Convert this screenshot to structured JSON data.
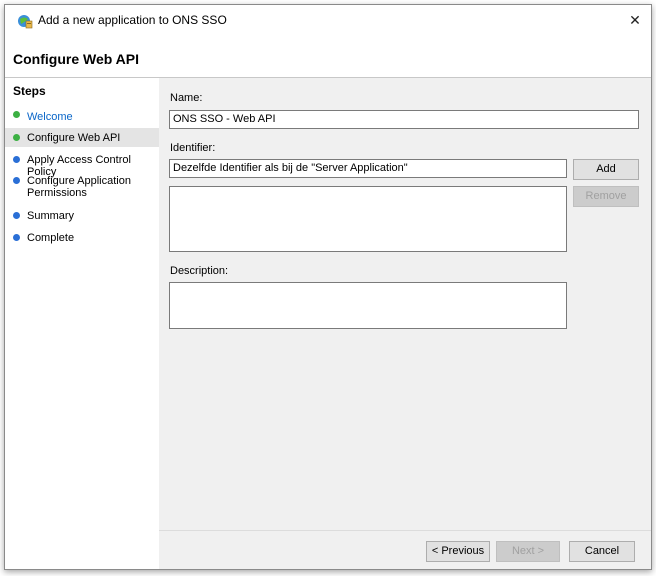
{
  "window": {
    "title": "Add a new application to ONS SSO",
    "close_label": "✕",
    "page_title": "Configure Web API"
  },
  "steps": {
    "heading": "Steps",
    "items": [
      {
        "label": "Welcome",
        "status": "complete",
        "color": "#3cb043"
      },
      {
        "label": "Configure Web API",
        "status": "current",
        "color": "#3cb043"
      },
      {
        "label": "Apply Access Control Policy",
        "status": "pending",
        "color": "#2a6fd6"
      },
      {
        "label": "Configure Application Permissions",
        "status": "pending",
        "color": "#2a6fd6"
      },
      {
        "label": "Summary",
        "status": "pending",
        "color": "#2a6fd6"
      },
      {
        "label": "Complete",
        "status": "pending",
        "color": "#2a6fd6"
      }
    ]
  },
  "form": {
    "name_label": "Name:",
    "name_value": "ONS SSO - Web API",
    "identifier_label": "Identifier:",
    "identifier_value": "Dezelfde Identifier als bij de \"Server Application\"",
    "add_label": "Add",
    "remove_label": "Remove",
    "description_label": "Description:",
    "description_value": ""
  },
  "footer": {
    "previous_label": "< Previous",
    "next_label": "Next >",
    "cancel_label": "Cancel"
  },
  "icons": {
    "app": "adfs-application-icon",
    "close": "close-icon"
  }
}
